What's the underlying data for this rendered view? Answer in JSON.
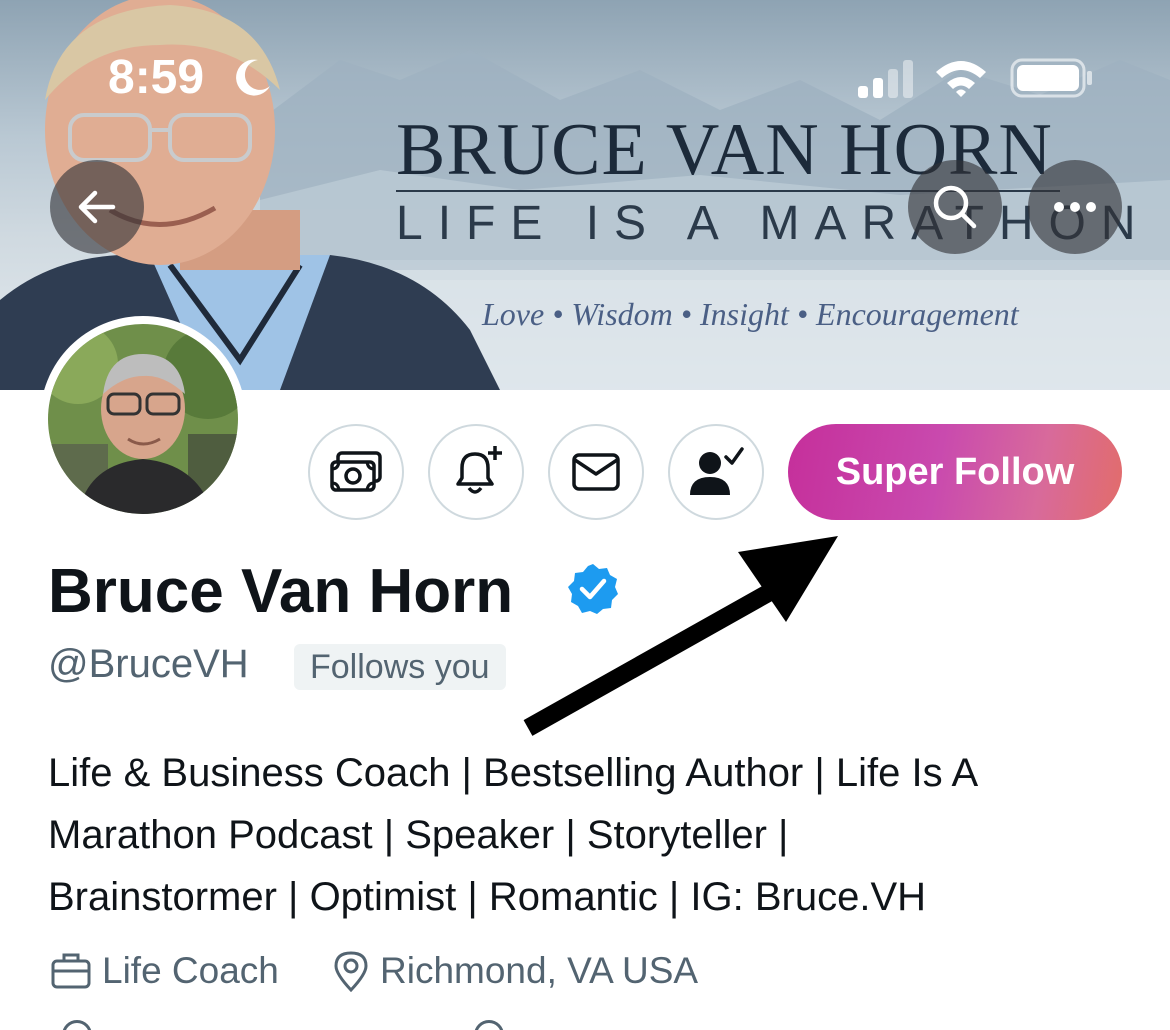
{
  "status_bar": {
    "time": "8:59"
  },
  "banner": {
    "title": "BRUCE VAN HORN",
    "subtitle": "LIFE IS A MARATHON",
    "tagline": "Love • Wisdom • Insight • Encouragement"
  },
  "actions": {
    "super_follow_label": "Super Follow"
  },
  "profile": {
    "name": "Bruce Van Horn",
    "handle": "@BruceVH",
    "follows_you": "Follows you",
    "bio_lines": [
      "Life & Business Coach | Bestselling Author | Life Is A",
      "Marathon Podcast | Speaker | Storyteller |",
      "Brainstormer | Optimist | Romantic | IG: Bruce.VH"
    ],
    "profession": "Life Coach",
    "location": "Richmond, VA USA"
  },
  "colors": {
    "verified_blue": "#1d9bf0",
    "secondary_text": "#536471",
    "super_follow_start": "#c52f9b",
    "super_follow_end": "#e26c6a"
  },
  "icons": {
    "back": "arrow-left-icon",
    "search": "search-icon",
    "more": "more-icon",
    "tip": "money-icon",
    "notify": "bell-plus-icon",
    "message": "envelope-icon",
    "following": "person-check-icon",
    "verified": "verified-badge-icon",
    "profession": "briefcase-icon",
    "location": "location-pin-icon"
  }
}
